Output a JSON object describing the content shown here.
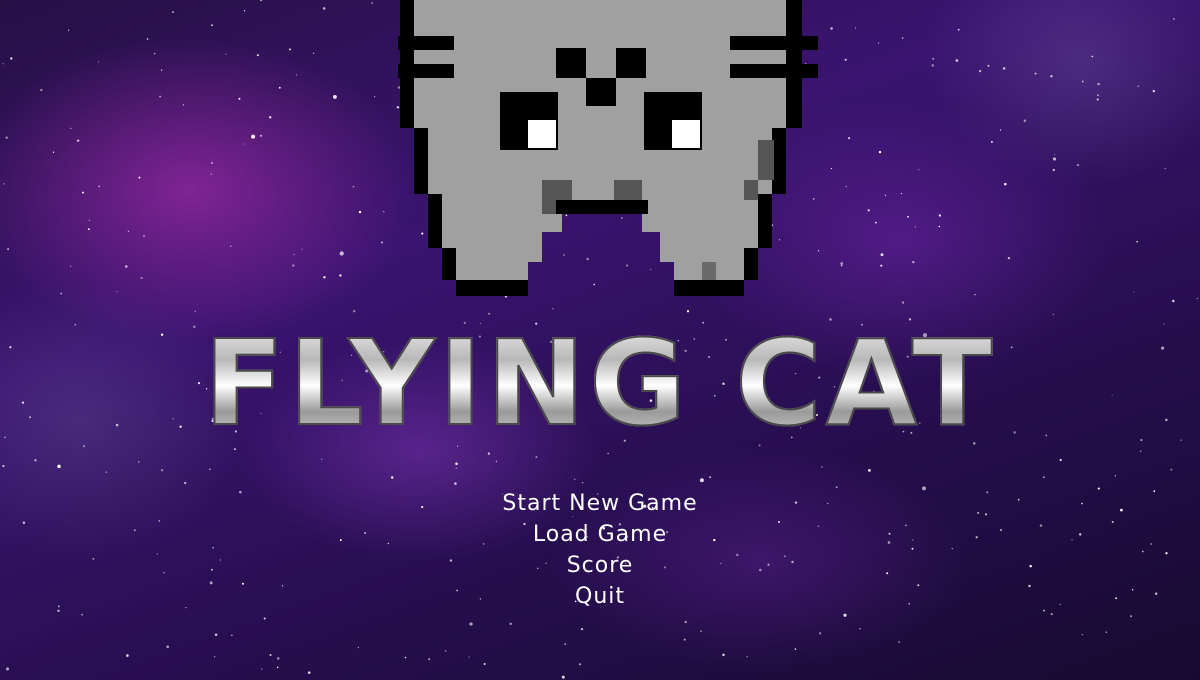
{
  "game": {
    "title": "FLYING CAT"
  },
  "menu": {
    "items": [
      {
        "label": "Start New Game"
      },
      {
        "label": "Load Game"
      },
      {
        "label": "Score"
      },
      {
        "label": "Quit"
      }
    ]
  },
  "colors": {
    "background": "#2a0f55",
    "nebula": "#be32be",
    "cat_body": "#a0a0a0",
    "cat_shadow": "#555555",
    "cat_outline": "#000000",
    "text": "#ffffff"
  }
}
